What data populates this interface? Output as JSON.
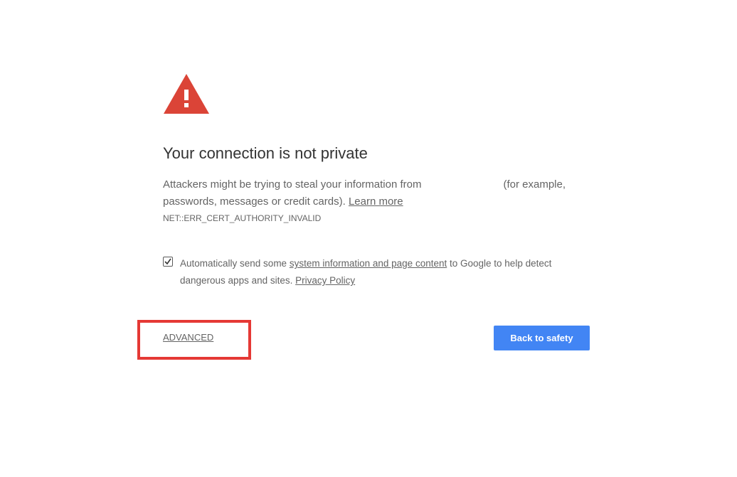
{
  "interstitial": {
    "title": "Your connection is not private",
    "description_part1": "Attackers might be trying to steal your information from",
    "description_part2": "(for example,",
    "description_line2": "passwords, messages or credit cards).",
    "learn_more": "Learn more",
    "error_code": "NET::ERR_CERT_AUTHORITY_INVALID"
  },
  "reporting": {
    "checked": true,
    "text_before": "Automatically send some",
    "link_text": "system information and page content",
    "text_after": "to Google to help detect",
    "line2": "dangerous apps and sites.",
    "privacy_link": "Privacy Policy"
  },
  "actions": {
    "advanced_label": "ADVANCED",
    "back_label": "Back to safety"
  },
  "colors": {
    "warning_red": "#db4437",
    "primary_blue": "#4285f4",
    "highlight_red": "#e53935"
  },
  "icons": {
    "warning": "warning-triangle-icon",
    "checkmark": "checkmark-icon"
  }
}
